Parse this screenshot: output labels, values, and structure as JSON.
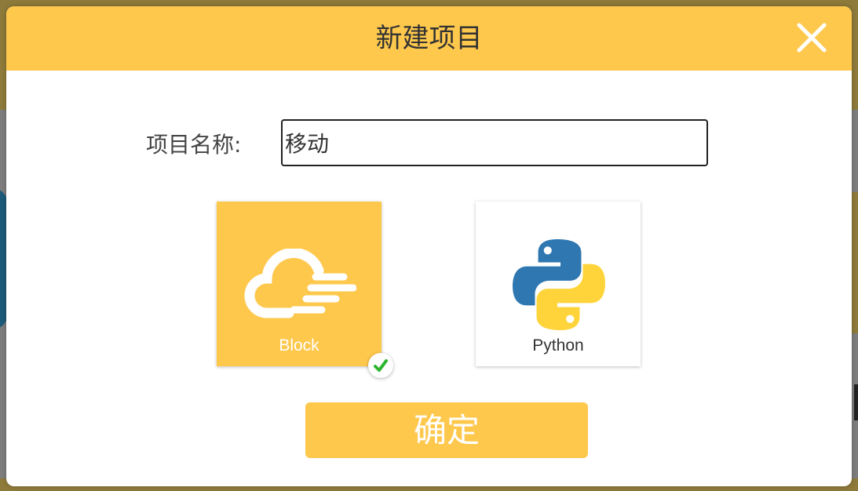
{
  "dialog": {
    "title": "新建项目",
    "close_icon": "close-icon"
  },
  "form": {
    "name_label": "项目名称:",
    "name_value": "移动"
  },
  "project_types": [
    {
      "label": "Block",
      "icon": "cloud-wind-icon",
      "selected": true
    },
    {
      "label": "Python",
      "icon": "python-logo-icon",
      "selected": false
    }
  ],
  "selected_icon": "checkmark-icon",
  "confirm_label": "确定",
  "colors": {
    "accent": "#fec84d",
    "title_text": "#333333",
    "check_green": "#2db52d",
    "python_blue": "#2f77b1",
    "python_yellow": "#ffd43b"
  }
}
